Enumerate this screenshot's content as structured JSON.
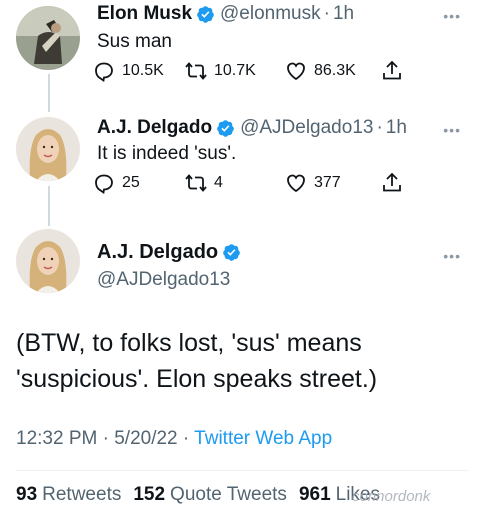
{
  "tweet1": {
    "name": "Elon Musk",
    "handle": "@elonmusk",
    "time": "1h",
    "text": "Sus man",
    "replies": "10.5K",
    "retweets": "10.7K",
    "likes": "86.3K",
    "more_icon": "more-dots-icon"
  },
  "tweet2": {
    "name": "A.J. Delgado",
    "handle": "@AJDelgado13",
    "time": "1h",
    "text": "It is indeed 'sus'.",
    "replies": "25",
    "retweets": "4",
    "likes": "377"
  },
  "main_tweet": {
    "name": "A.J. Delgado",
    "handle": "@AJDelgado13",
    "text": "(BTW, to folks lost, 'sus' means 'suspicious'. Elon speaks street.)",
    "time": "12:32 PM",
    "date": "5/20/22",
    "app": "Twitter Web App",
    "retweets_count": "93",
    "retweets_label": "Retweets",
    "quote_count": "152",
    "quote_label": "Quote Tweets",
    "likes_count": "961",
    "likes_label": "Likes"
  },
  "watermark": "connordonk",
  "colors": {
    "verified": "#1d9bf0",
    "text": "#0f1419",
    "secondary": "#536471",
    "link": "#1d9bf0"
  },
  "icons": [
    "reply-icon",
    "retweet-icon",
    "like-icon",
    "share-icon",
    "verified-badge-icon",
    "more-dots-icon"
  ]
}
